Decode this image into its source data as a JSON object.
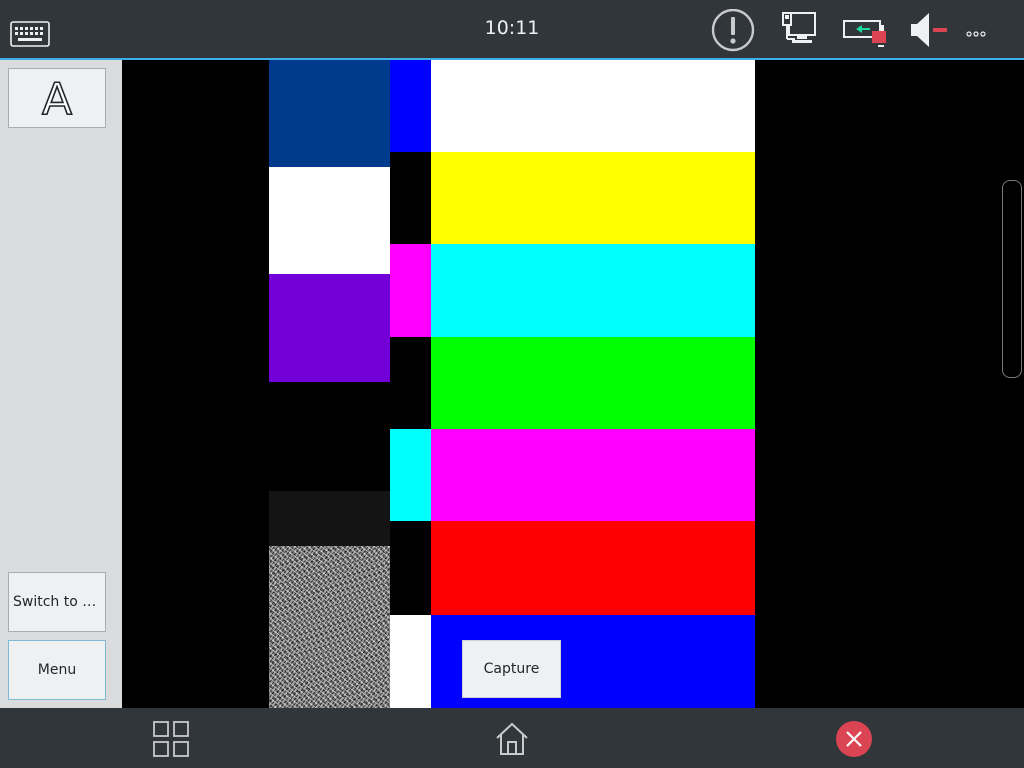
{
  "topbar": {
    "clock": "10:11",
    "icons": [
      "keyboard-icon",
      "warning-icon",
      "network-wired-icon",
      "battery-icon",
      "volume-muted-icon",
      "more-icon"
    ],
    "accent_color": "#3daee9"
  },
  "sidebar": {
    "font_button_label": "A",
    "switch_button_label": "Switch to Vi...",
    "menu_button_label": "Menu"
  },
  "video": {
    "description_colors": {
      "column1": [
        "#003a8c",
        "#ffffff",
        "#7300d6",
        "#000000",
        "#141414"
      ],
      "column2": [
        "#0000ff",
        "#000000",
        "#ff00ff",
        "#000000",
        "#00ffff",
        "#000000",
        "#ffffff"
      ],
      "column3": [
        "#ffffff",
        "#ffff00",
        "#00ffff",
        "#00ff00",
        "#ff00ff",
        "#ff0000",
        "#0000ff"
      ]
    },
    "capture_button_label": "Capture"
  },
  "bottombar": {
    "icons": [
      "apps-grid-icon",
      "home-icon",
      "close-icon"
    ],
    "close_color": "#da4453"
  }
}
